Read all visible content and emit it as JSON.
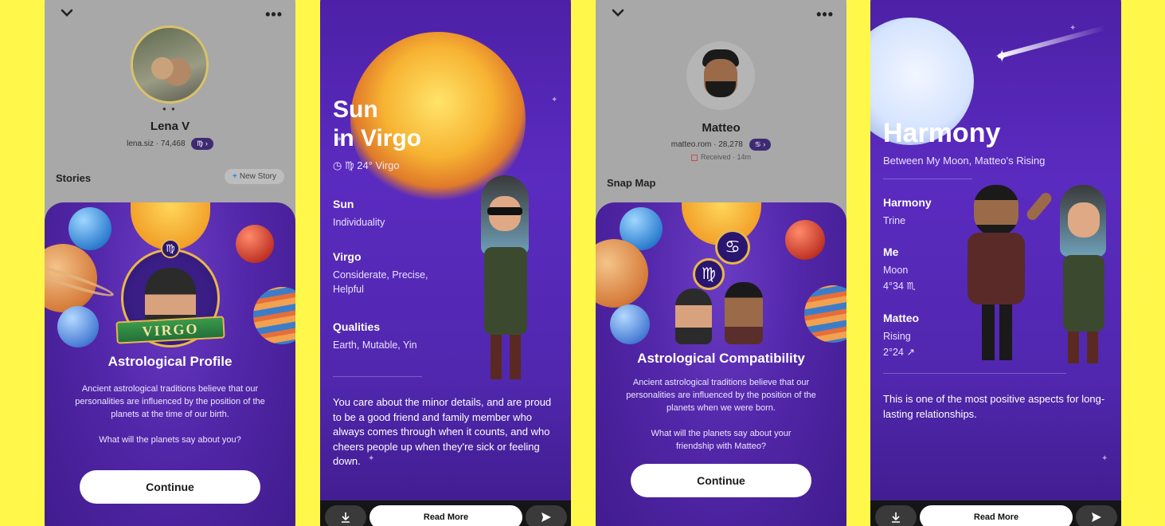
{
  "panel1": {
    "profile_name": "Lena V",
    "username": "lena.siz",
    "score": "74,468",
    "zodiac_pill": "♍ ›",
    "stories_label": "Stories",
    "new_story_label": "New Story",
    "zodiac_banner": "VIRGO",
    "title": "Astrological Profile",
    "body": "Ancient astrological traditions believe that our personalities are influenced by the position of the planets at the time of our birth.",
    "question": "What will the planets say about you?",
    "continue_label": "Continue"
  },
  "panel2": {
    "title_line1": "Sun",
    "title_line2": "in Virgo",
    "degree": "♍ 24° Virgo",
    "sections": [
      {
        "label": "Sun",
        "value": "Individuality"
      },
      {
        "label": "Virgo",
        "value": "Considerate, Precise, Helpful"
      },
      {
        "label": "Qualities",
        "value": "Earth, Mutable, Yin"
      }
    ],
    "description": "You care about the minor details, and are proud to be a good friend and family member who always comes through when it counts, and who cheers people up when they're sick or feeling down.",
    "read_more_label": "Read More"
  },
  "panel3": {
    "profile_name": "Matteo",
    "username": "matteo.rom",
    "score": "28,278",
    "zodiac_pill": "♋ ›",
    "received": "Received · 14m",
    "snap_map_label": "Snap Map",
    "title": "Astrological Compatibility",
    "body": "Ancient astrological traditions believe that our personalities are influenced by the position of the planets when we were born.",
    "question": "What will the planets say about your friendship with Matteo?",
    "continue_label": "Continue"
  },
  "panel4": {
    "title": "Harmony",
    "subtitle": "Between My Moon, Matteo's Rising",
    "sections": [
      {
        "label": "Harmony",
        "value1": "Trine",
        "value2": ""
      },
      {
        "label": "Me",
        "value1": "Moon",
        "value2": "4°34 ♏"
      },
      {
        "label": "Matteo",
        "value1": "Rising",
        "value2": "2°24 ↗"
      }
    ],
    "description": "This is one of the most positive aspects for long-lasting relationships.",
    "read_more_label": "Read More"
  }
}
